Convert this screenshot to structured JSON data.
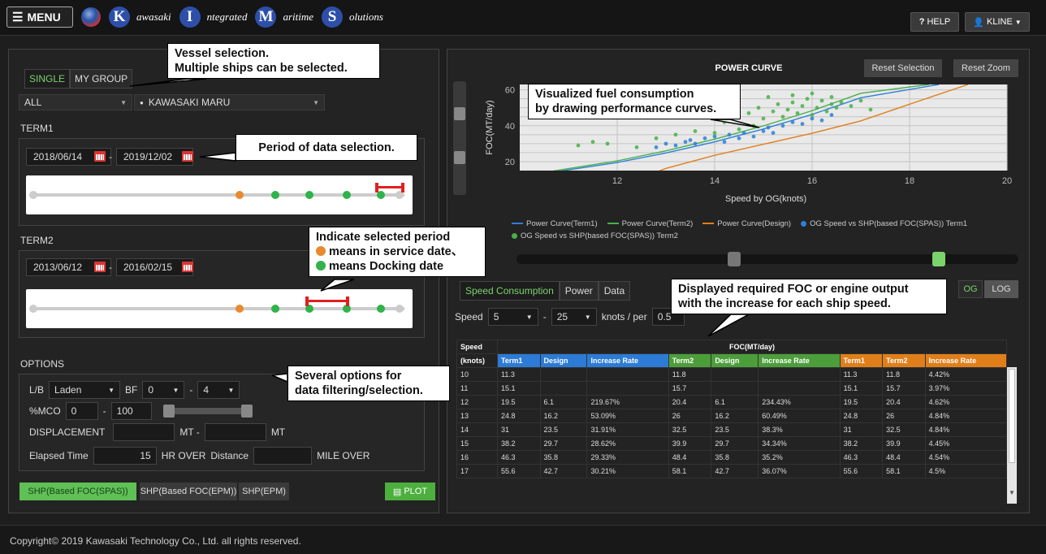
{
  "header": {
    "menu_label": "MENU",
    "brand": [
      {
        "cap": "K",
        "rest": "awasaki"
      },
      {
        "cap": "I",
        "rest": "ntegrated"
      },
      {
        "cap": "M",
        "rest": "aritime"
      },
      {
        "cap": "S",
        "rest": "olutions"
      }
    ],
    "help_label": "HELP",
    "user_label": "KLINE"
  },
  "left": {
    "tabs": [
      "SINGLE",
      "MY GROUP"
    ],
    "vessel_group": "ALL",
    "vessel_name": "KAWASAKI MARU",
    "term1": {
      "label": "TERM1",
      "from": "2018/06/14",
      "to": "2019/12/02"
    },
    "term2": {
      "label": "TERM2",
      "from": "2013/06/12",
      "to": "2016/02/15"
    },
    "options": {
      "label": "OPTIONS",
      "lb_label": "L/B",
      "lb_value": "Laden",
      "bf_label": "BF",
      "bf_from": "0",
      "bf_to": "4",
      "mco_label": "%MCO",
      "mco_from": "0",
      "mco_to": "100",
      "disp_label": "DISPLACEMENT",
      "mt1": "MT -",
      "mt2": "MT",
      "elapsed_label": "Elapsed Time",
      "elapsed_value": "15",
      "hr_over": "HR OVER",
      "distance_label": "Distance",
      "mile_over": "MILE OVER"
    },
    "buttons": [
      "SHP(Based FOC(SPAS))",
      "SHP(Based FOC(EPM))",
      "SHP(EPM)"
    ],
    "plot_label": "PLOT"
  },
  "callouts": {
    "vessel": [
      "Vessel selection.",
      "Multiple ships can be selected."
    ],
    "period": "Period of data selection.",
    "indicate": [
      "Indicate selected period",
      "means in service date、",
      "means Docking date"
    ],
    "options": [
      "Several options for",
      "data filtering/selection."
    ],
    "visualized": [
      "Visualized fuel consumption",
      "by drawing performance curves."
    ],
    "displayed": [
      "Displayed required FOC or engine output",
      "with the increase for each ship speed."
    ]
  },
  "right": {
    "reset_selection": "Reset Selection",
    "reset_zoom": "Reset Zoom",
    "tabs": [
      "Speed Consumption",
      "Power",
      "Data"
    ],
    "og_label": "OG",
    "log_label": "LOG",
    "speed_label": "Speed",
    "speed_from": "5",
    "speed_to": "25",
    "knots_per": "knots / per",
    "per_value": "0.5",
    "legend": [
      {
        "name": "Power Curve(Term1)",
        "color": "#2e7fd8",
        "kind": "line"
      },
      {
        "name": "Power Curve(Term2)",
        "color": "#47b04a",
        "kind": "line"
      },
      {
        "name": "Power Curve(Design)",
        "color": "#e07f1a",
        "kind": "line"
      },
      {
        "name": "OG Speed vs SHP(based FOC(SPAS)) Term1",
        "color": "#2e7fd8",
        "kind": "dot"
      },
      {
        "name": "OG Speed vs SHP(based FOC(SPAS)) Term2",
        "color": "#47b04a",
        "kind": "dot"
      }
    ]
  },
  "chart_data": {
    "type": "scatter",
    "title": "POWER CURVE",
    "xlabel": "Speed by OG(knots)",
    "ylabel": "FOC(MT/day)",
    "xlim": [
      10,
      20
    ],
    "ylim": [
      15,
      63
    ],
    "xticks": [
      12,
      14,
      16,
      18,
      20
    ],
    "yticks": [
      20,
      40,
      60
    ],
    "grid": true,
    "series": [
      {
        "name": "Power Curve(Term1)",
        "kind": "line",
        "color": "#2e7fd8",
        "x": [
          10,
          12,
          13,
          14,
          15,
          16,
          17,
          18.6
        ],
        "y": [
          11.3,
          19.5,
          24.8,
          31,
          38.2,
          46.3,
          55.6,
          63
        ]
      },
      {
        "name": "Power Curve(Term2)",
        "kind": "line",
        "color": "#47b04a",
        "x": [
          10,
          12,
          13,
          14,
          15,
          16,
          17,
          18.4
        ],
        "y": [
          11.8,
          20.4,
          26,
          32.5,
          39.9,
          48.4,
          58.1,
          63
        ]
      },
      {
        "name": "Power Curve(Design)",
        "kind": "line",
        "color": "#e07f1a",
        "x": [
          12,
          13,
          14,
          15,
          16,
          17,
          18,
          19.2
        ],
        "y": [
          6.1,
          16.2,
          23.5,
          29.7,
          35.8,
          42.7,
          52,
          63
        ]
      },
      {
        "name": "OG Speed vs SHP(based FOC(SPAS)) Term1",
        "kind": "scatter",
        "color": "#2e7fd8",
        "x": [
          12.8,
          13.0,
          13.2,
          13.4,
          13.5,
          13.6,
          13.8,
          14.0,
          14.2,
          14.3,
          14.5,
          14.6,
          14.8,
          15.0,
          15.1,
          15.2,
          15.4,
          15.6,
          15.8,
          16.0,
          16.2,
          16.4
        ],
        "y": [
          28,
          30,
          29,
          31,
          32,
          30,
          33,
          34,
          31,
          35,
          33,
          36,
          34,
          37,
          39,
          36,
          40,
          42,
          41,
          44,
          43,
          46
        ]
      },
      {
        "name": "OG Speed vs SHP(based FOC(SPAS)) Term2",
        "kind": "scatter",
        "color": "#47b04a",
        "x": [
          11.2,
          11.5,
          11.8,
          12.4,
          12.8,
          13.2,
          13.6,
          14.0,
          14.2,
          14.5,
          14.7,
          14.9,
          15.0,
          15.2,
          15.3,
          15.4,
          15.5,
          15.6,
          15.7,
          15.8,
          15.9,
          16.0,
          16.1,
          16.2,
          16.3,
          16.4,
          16.5,
          16.6,
          16.8,
          17.0,
          17.2,
          15.1,
          15.6,
          16.0,
          16.4,
          14.8,
          13.9
        ],
        "y": [
          29,
          31,
          30,
          28,
          33,
          35,
          37,
          36,
          42,
          38,
          47,
          50,
          44,
          48,
          52,
          45,
          49,
          53,
          47,
          51,
          55,
          46,
          50,
          54,
          48,
          52,
          50,
          53,
          51,
          54,
          49,
          56,
          57,
          58,
          56,
          40,
          45
        ]
      }
    ]
  },
  "table": {
    "speed_header": "Speed",
    "foc_header": "FOC(MT/day)",
    "knots_header": "(knots)",
    "columns": [
      {
        "label": "Term1",
        "group": "blue"
      },
      {
        "label": "Design",
        "group": "blue"
      },
      {
        "label": "Increase Rate",
        "group": "blue"
      },
      {
        "label": "Term2",
        "group": "green"
      },
      {
        "label": "Design",
        "group": "green"
      },
      {
        "label": "Increase Rate",
        "group": "green"
      },
      {
        "label": "Term1",
        "group": "orange"
      },
      {
        "label": "Term2",
        "group": "orange"
      },
      {
        "label": "Increase Rate",
        "group": "orange"
      }
    ],
    "rows": [
      [
        "10",
        "11.3",
        "",
        "",
        "11.8",
        "",
        "",
        "11.3",
        "11.8",
        "4.42%"
      ],
      [
        "11",
        "15.1",
        "",
        "",
        "15.7",
        "",
        "",
        "15.1",
        "15.7",
        "3.97%"
      ],
      [
        "12",
        "19.5",
        "6.1",
        "219.67%",
        "20.4",
        "6.1",
        "234.43%",
        "19.5",
        "20.4",
        "4.62%"
      ],
      [
        "13",
        "24.8",
        "16.2",
        "53.09%",
        "26",
        "16.2",
        "60.49%",
        "24.8",
        "26",
        "4.84%"
      ],
      [
        "14",
        "31",
        "23.5",
        "31.91%",
        "32.5",
        "23.5",
        "38.3%",
        "31",
        "32.5",
        "4.84%"
      ],
      [
        "15",
        "38.2",
        "29.7",
        "28.62%",
        "39.9",
        "29.7",
        "34.34%",
        "38.2",
        "39.9",
        "4.45%"
      ],
      [
        "16",
        "46.3",
        "35.8",
        "29.33%",
        "48.4",
        "35.8",
        "35.2%",
        "46.3",
        "48.4",
        "4.54%"
      ],
      [
        "17",
        "55.6",
        "42.7",
        "30.21%",
        "58.1",
        "42.7",
        "36.07%",
        "55.6",
        "58.1",
        "4.5%"
      ]
    ]
  },
  "footer": "Copyright© 2019 Kawasaki Technology Co., Ltd. all rights reserved."
}
